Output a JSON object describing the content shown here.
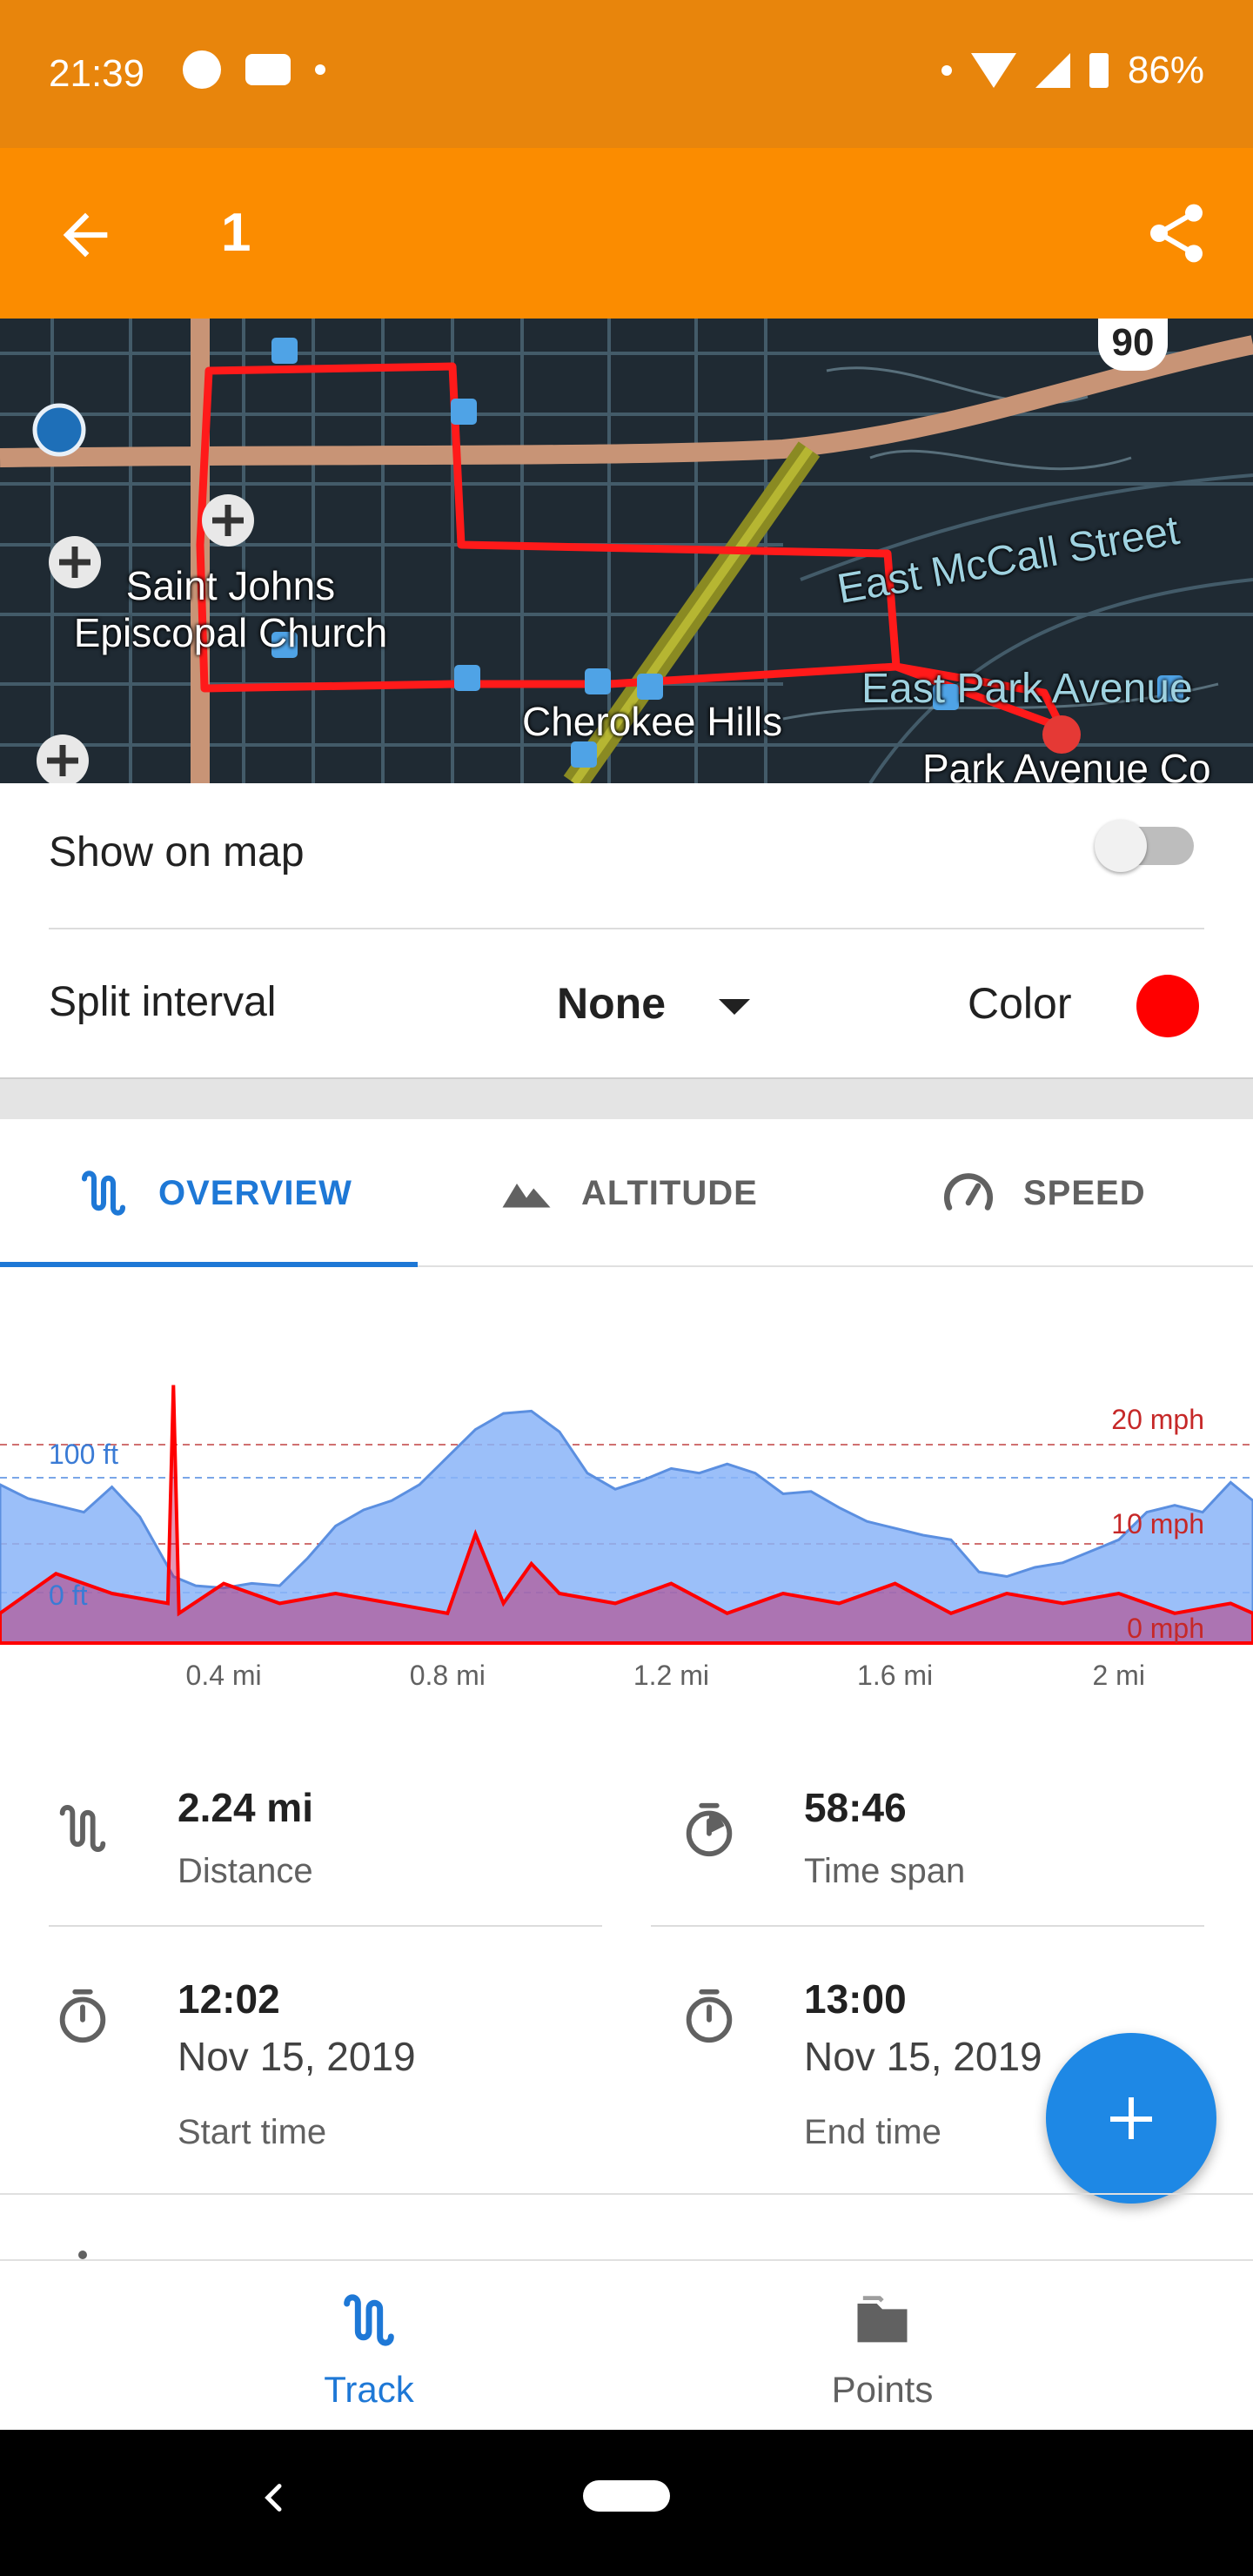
{
  "status_bar": {
    "time": "21:39",
    "battery": "86%"
  },
  "app_bar": {
    "title": "1",
    "back_icon": "arrow-back-icon",
    "share_icon": "share-icon"
  },
  "map": {
    "labels": {
      "church": "Saint Johns Episcopal Church",
      "cherokee": "Cherokee Hills",
      "mccall": "East McCall Street",
      "park_ave": "East Park Avenue",
      "park_ave_co": "Park Avenue Co",
      "route": "90"
    }
  },
  "settings": {
    "show_on_map_label": "Show on map",
    "show_on_map_value": false,
    "split_interval_label": "Split interval",
    "split_interval_value": "None",
    "color_label": "Color",
    "color_value": "#ff0000"
  },
  "tabs": [
    {
      "label": "OVERVIEW",
      "icon": "route-icon",
      "selected": true
    },
    {
      "label": "ALTITUDE",
      "icon": "mountains-icon",
      "selected": false
    },
    {
      "label": "SPEED",
      "icon": "speedometer-icon",
      "selected": false
    }
  ],
  "chart_data": {
    "type": "area",
    "x_unit": "mi",
    "xlim": [
      0,
      2.24
    ],
    "x_ticks": [
      "0.4 mi",
      "0.8 mi",
      "1.2 mi",
      "1.6 mi",
      "2 mi"
    ],
    "left_axis": {
      "ticks": [
        "100 ft",
        "0 ft"
      ],
      "color": "#3a7bd5"
    },
    "right_axis": {
      "ticks": [
        "20 mph",
        "10 mph",
        "0 mph"
      ],
      "color": "#c62828"
    },
    "series": [
      {
        "name": "Altitude",
        "unit": "ft",
        "color": "#8ab4f8",
        "x": [
          0,
          0.05,
          0.1,
          0.15,
          0.2,
          0.25,
          0.31,
          0.35,
          0.4,
          0.45,
          0.5,
          0.55,
          0.6,
          0.65,
          0.7,
          0.75,
          0.8,
          0.85,
          0.9,
          0.95,
          1.0,
          1.05,
          1.1,
          1.15,
          1.2,
          1.25,
          1.3,
          1.35,
          1.4,
          1.45,
          1.5,
          1.55,
          1.6,
          1.65,
          1.7,
          1.75,
          1.8,
          1.85,
          1.9,
          1.95,
          2.0,
          2.05,
          2.1,
          2.15,
          2.2,
          2.24
        ],
        "y": [
          94,
          82,
          76,
          70,
          92,
          66,
          14,
          6,
          4,
          8,
          6,
          30,
          58,
          72,
          80,
          94,
          118,
          142,
          156,
          158,
          140,
          104,
          90,
          98,
          108,
          104,
          112,
          104,
          86,
          88,
          74,
          62,
          56,
          50,
          46,
          18,
          14,
          22,
          26,
          36,
          46,
          70,
          76,
          70,
          96,
          80
        ]
      },
      {
        "name": "Speed",
        "unit": "mph",
        "color": "#ff0000",
        "x": [
          0,
          0.1,
          0.2,
          0.3,
          0.31,
          0.32,
          0.4,
          0.5,
          0.6,
          0.7,
          0.8,
          0.85,
          0.9,
          0.95,
          1.0,
          1.1,
          1.2,
          1.3,
          1.4,
          1.5,
          1.6,
          1.7,
          1.8,
          1.9,
          2.0,
          2.1,
          2.2,
          2.24
        ],
        "y": [
          3,
          7,
          5,
          4,
          26,
          3,
          6,
          4,
          5,
          4,
          3,
          11,
          4,
          8,
          5,
          4,
          6,
          3,
          5,
          4,
          6,
          3,
          5,
          4,
          5,
          3,
          4,
          3
        ]
      }
    ]
  },
  "stats": {
    "distance": {
      "value": "2.24 mi",
      "label": "Distance",
      "icon": "route-icon"
    },
    "time_span": {
      "value": "58:46",
      "label": "Time span",
      "icon": "stopwatch-icon"
    },
    "start": {
      "time": "12:02",
      "date": "Nov 15, 2019",
      "label": "Start time",
      "icon": "stopwatch-icon"
    },
    "end": {
      "time": "13:00",
      "date": "Nov 15, 2019",
      "label": "End time",
      "icon": "stopwatch-icon"
    }
  },
  "bottom_nav": [
    {
      "label": "Track",
      "icon": "route-icon",
      "selected": true
    },
    {
      "label": "Points",
      "icon": "folder-icon",
      "selected": false
    }
  ]
}
